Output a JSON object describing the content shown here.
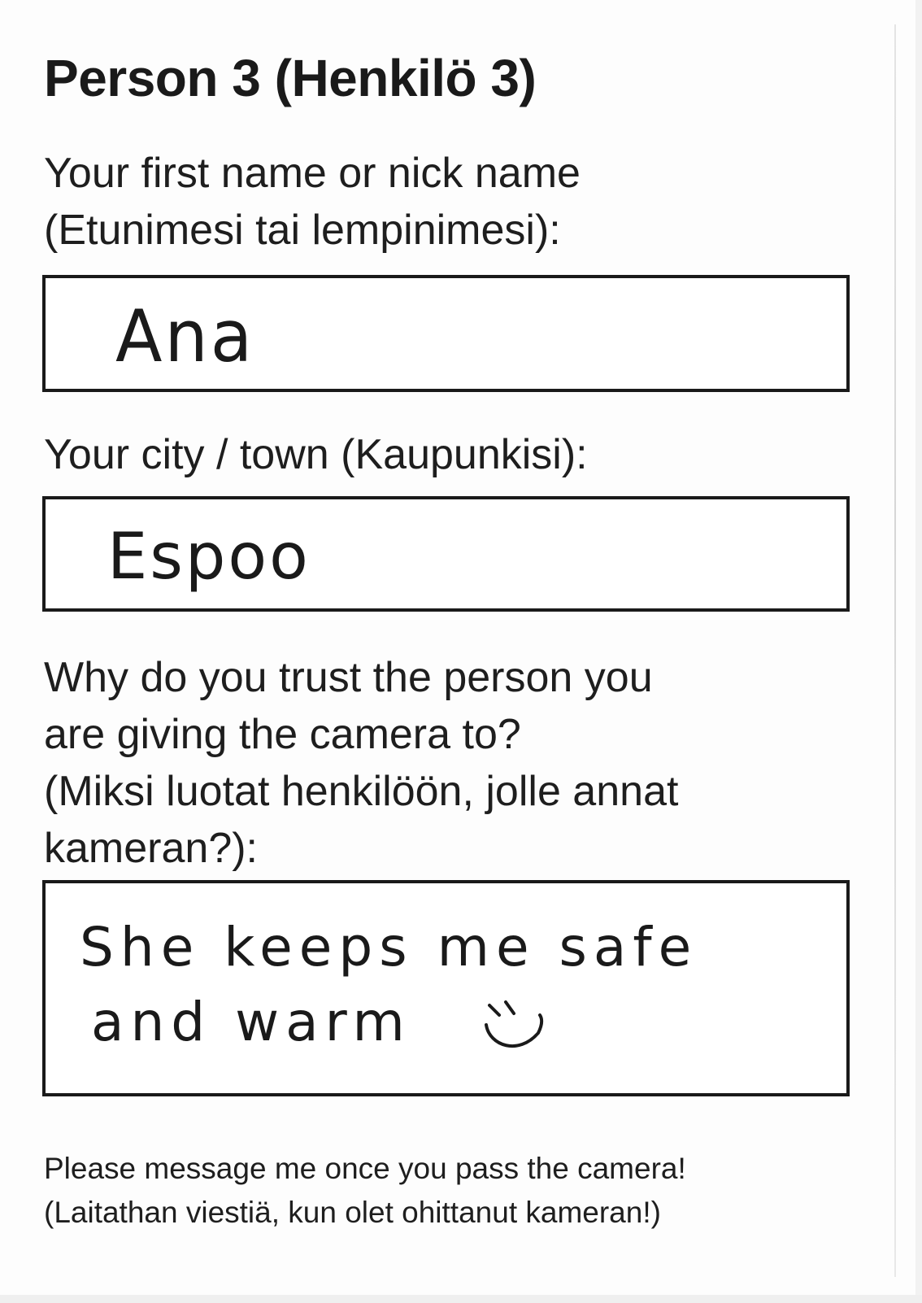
{
  "title": "Person 3 (Henkilö 3)",
  "name_question": {
    "line1": "Your first name or nick name",
    "line2": "(Etunimesi tai lempinimesi):",
    "answer": "Ana"
  },
  "city_question": {
    "line1": "Your city / town (Kaupunkisi):",
    "answer": "Espoo"
  },
  "trust_question": {
    "line1": "Why do you trust the person you",
    "line2": "are giving the camera to?",
    "line3": "(Miksi luotat henkilöön, jolle annat",
    "line4": "kameran?):",
    "answer_line1": "She keeps me safe",
    "answer_line2": "and warm",
    "smiley": "smiley-face-doodle"
  },
  "footer_note": {
    "line1": "Please message me once you pass the camera!",
    "line2": "(Laitathan viestiä, kun olet ohittanut kameran!)"
  }
}
